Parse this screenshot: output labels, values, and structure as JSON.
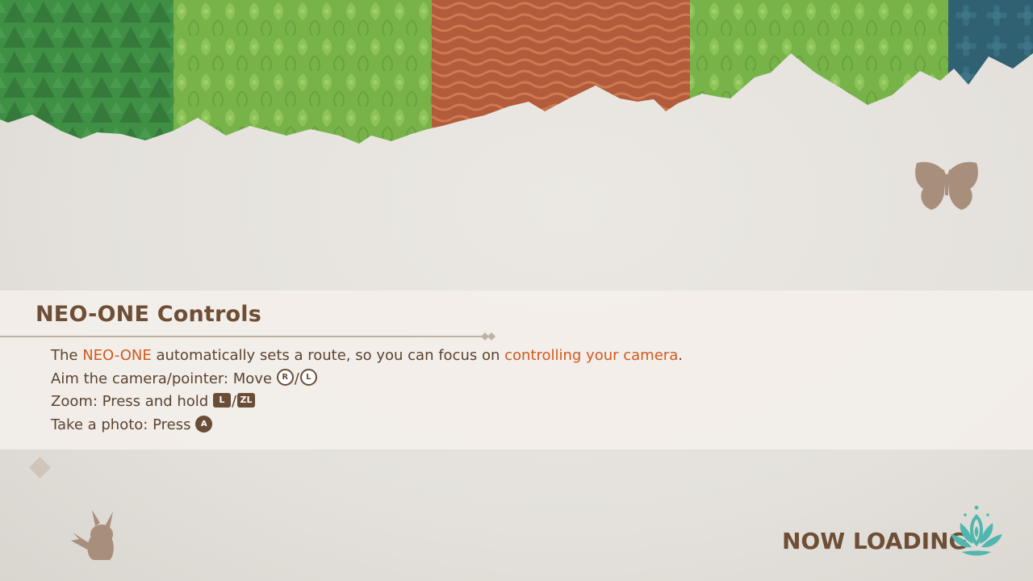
{
  "controls": {
    "title": "NEO-ONE Controls",
    "line1": {
      "pre": "The ",
      "highlight1": "NEO-ONE",
      "mid": " automatically sets a route, so you can focus on ",
      "highlight2": "controlling your camera",
      "post": "."
    },
    "line2": {
      "text": "Aim the camera/pointer: Move ",
      "button1": "R",
      "separator": "/",
      "button2": "L"
    },
    "line3": {
      "text": "Zoom: Press and hold ",
      "button1": "L",
      "separator": "/",
      "button2": "ZL"
    },
    "line4": {
      "text": "Take a photo: Press ",
      "button1": "A"
    }
  },
  "loading": {
    "label": "NOW LOADING"
  },
  "icons": {
    "top_right": "butterfly-silhouette-icon",
    "bottom_left": "pikachu-silhouette-icon",
    "left_marker": "diamond-icon",
    "loading_spinner": "lotus-icon"
  },
  "colors": {
    "background": "#e6e3de",
    "title": "#6e4e35",
    "text": "#5b4431",
    "highlight": "#d2591d",
    "silhouette": "#a88f7c",
    "lotus": "#4fb7ae"
  }
}
